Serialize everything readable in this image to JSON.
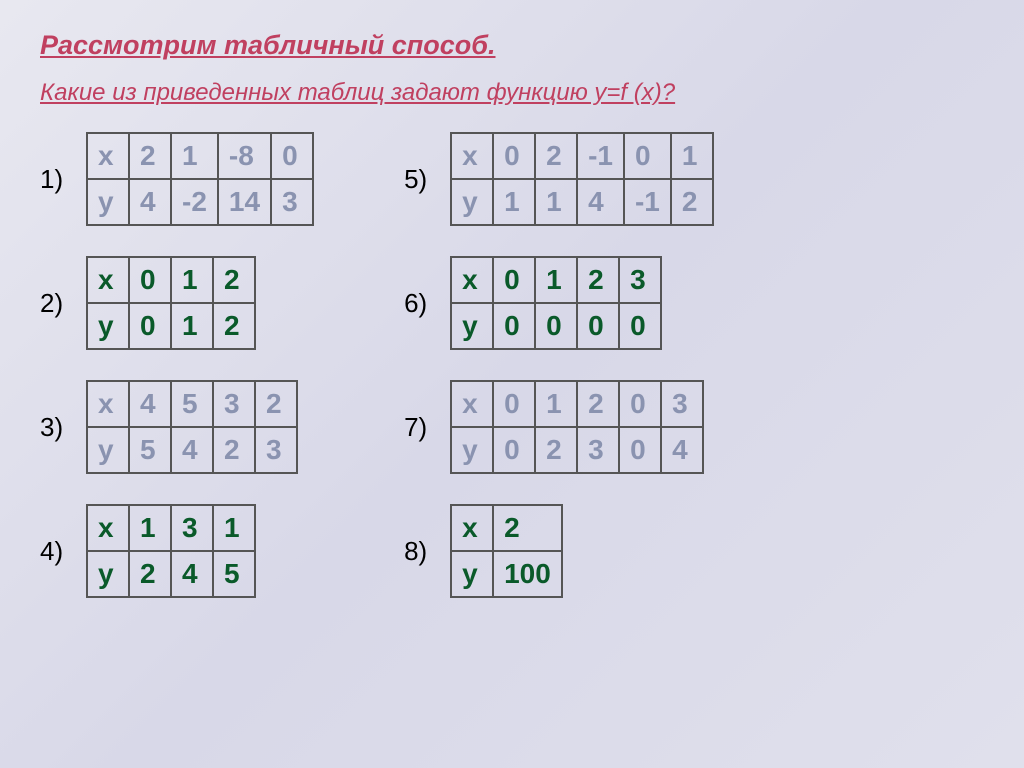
{
  "title": "Рассмотрим табличный способ.",
  "subtitle": "Какие из приведенных таблиц задают функцию y=f (x)?",
  "tables": [
    {
      "num": "1)",
      "style": "gray",
      "x": [
        "х",
        "2",
        "1",
        "-8",
        "0"
      ],
      "y": [
        "у",
        "4",
        "-2",
        "14",
        "3"
      ]
    },
    {
      "num": "2)",
      "style": "grn",
      "x": [
        "х",
        "0",
        "1",
        "2"
      ],
      "y": [
        "у",
        "0",
        "1",
        "2"
      ]
    },
    {
      "num": "3)",
      "style": "gray",
      "x": [
        "х",
        "4",
        "5",
        "3",
        "2"
      ],
      "y": [
        "у",
        "5",
        "4",
        "2",
        "3"
      ]
    },
    {
      "num": "4)",
      "style": "grn",
      "x": [
        "х",
        "1",
        "3",
        "1"
      ],
      "y": [
        "у",
        "2",
        "4",
        "5"
      ]
    },
    {
      "num": "5)",
      "style": "gray",
      "x": [
        "х",
        "0",
        "2",
        "-1",
        "0",
        "1"
      ],
      "y": [
        "у",
        "1",
        "1",
        "4",
        "-1",
        "2"
      ]
    },
    {
      "num": "6)",
      "style": "grn",
      "x": [
        "х",
        "0",
        "1",
        "2",
        "3"
      ],
      "y": [
        "у",
        "0",
        "0",
        "0",
        "0"
      ]
    },
    {
      "num": "7)",
      "style": "gray",
      "x": [
        "х",
        "0",
        "1",
        "2",
        "0",
        "3"
      ],
      "y": [
        "у",
        "0",
        "2",
        "3",
        "0",
        "4"
      ]
    },
    {
      "num": "8)",
      "style": "grn",
      "x": [
        "х",
        "2"
      ],
      "y": [
        "у",
        "100"
      ]
    }
  ]
}
